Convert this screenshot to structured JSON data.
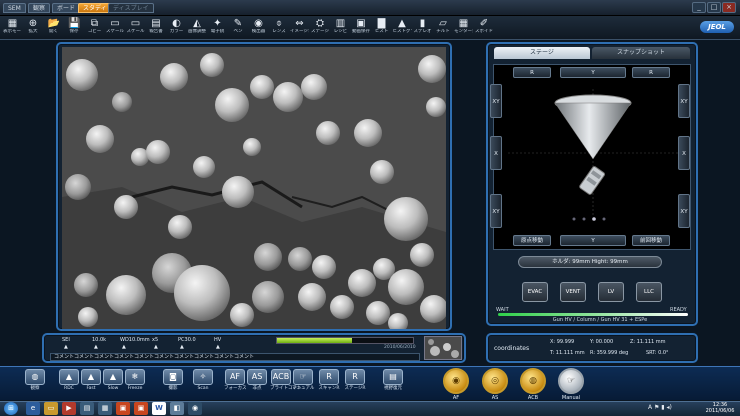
{
  "titlebar": {
    "tabs": [
      {
        "label": "SEM",
        "state": "normal"
      },
      {
        "label": "観察",
        "state": "normal"
      },
      {
        "label": "ボード",
        "state": "normal"
      },
      {
        "label": "スタディ",
        "state": "active"
      },
      {
        "label": "ディスプレイ",
        "state": "dim"
      }
    ],
    "controls": [
      "_",
      "□",
      "×"
    ]
  },
  "toolbar": {
    "items": [
      {
        "icon": "display-mode-icon",
        "glyph": "▦",
        "label": "表示モード"
      },
      {
        "icon": "zoom-icon",
        "glyph": "⊕",
        "label": "拡大"
      },
      {
        "icon": "open-folder-icon",
        "glyph": "📂",
        "label": "開く"
      },
      {
        "icon": "save-icon",
        "glyph": "💾",
        "label": "保存"
      },
      {
        "icon": "copy-icon",
        "glyph": "⧉",
        "label": "コピー"
      },
      {
        "icon": "scale-icon",
        "glyph": "▭",
        "label": "スケール"
      },
      {
        "icon": "scale2-icon",
        "glyph": "▭",
        "label": "スケール"
      },
      {
        "icon": "report-icon",
        "glyph": "▤",
        "label": "報告書"
      },
      {
        "icon": "color-icon",
        "glyph": "◐",
        "label": "カラー"
      },
      {
        "icon": "image-adjust-icon",
        "glyph": "◭",
        "label": "画像調整"
      },
      {
        "icon": "electron-icon",
        "glyph": "✦",
        "label": "電子銃"
      },
      {
        "icon": "pencil-icon",
        "glyph": "✎",
        "label": "ペン"
      },
      {
        "icon": "detector-icon",
        "glyph": "◉",
        "label": "検出器"
      },
      {
        "icon": "lens-icon",
        "glyph": "⌽",
        "label": "レンズ"
      },
      {
        "icon": "image-shift-icon",
        "glyph": "⇔",
        "label": "イメージシフト"
      },
      {
        "icon": "stage-icon",
        "glyph": "⛭",
        "label": "ステージ"
      },
      {
        "icon": "recipe-icon",
        "glyph": "▥",
        "label": "レシピ"
      },
      {
        "icon": "video-icon",
        "glyph": "▣",
        "label": "動画保存"
      },
      {
        "icon": "histogram-icon",
        "glyph": "▇",
        "label": "ヒスト"
      },
      {
        "icon": "histogram2-icon",
        "glyph": "▲",
        "label": "ヒストグラム"
      },
      {
        "icon": "stereo-icon",
        "glyph": "▮",
        "label": "ステレオ"
      },
      {
        "icon": "tilt-icon",
        "glyph": "▱",
        "label": "チルト"
      },
      {
        "icon": "montage-icon",
        "glyph": "▦",
        "label": "モンタージュ"
      },
      {
        "icon": "eyedropper-icon",
        "glyph": "✐",
        "label": "スポイド"
      }
    ],
    "logo": "JEOL"
  },
  "right_panel": {
    "tabs": [
      {
        "label": "ステージ",
        "active": true
      },
      {
        "label": "スナップショット",
        "active": false
      }
    ],
    "top_buttons": [
      "R",
      "Y",
      "R"
    ],
    "side_left": [
      "XY",
      "X",
      "XY"
    ],
    "side_right": [
      "XY",
      "X",
      "XY"
    ],
    "bottom_buttons": [
      "原点移動",
      "Y",
      "前回移動"
    ],
    "holder_text": "ホルダ:  99mm    Hight:  99mm",
    "vac_buttons": [
      "EVAC",
      "VENT",
      "LV",
      "LLC"
    ],
    "wait_label": "WAIT",
    "ready_label": "READY",
    "status_text": "Gun HV / Column / Gun HV 31 + ESPe"
  },
  "info": {
    "params": [
      {
        "label": "SEI",
        "value": "SEI"
      },
      {
        "label": "10.0k",
        "value": "10.0k"
      },
      {
        "label": "WD10.0mm",
        "value": "WD10.0mm"
      },
      {
        "label": "x5",
        "value": "x5"
      },
      {
        "label": "PC30.0",
        "value": "PC30.0"
      },
      {
        "label": "HV",
        "value": "HV"
      }
    ],
    "progress": 0.55,
    "date": "2010/06/2010",
    "comment": "コメントコメントコメントコメントコメントコメントコメントコメントコメントコメント"
  },
  "coordinates": {
    "title": "coordinates",
    "x": "X: 99.999",
    "y": "Y: 00.000",
    "z": "Z: 11.111 mm",
    "t": "T: 11.111 mm",
    "r": "R: 359.999 deg",
    "srt": "SRT:  0.0°"
  },
  "bottom_bar": {
    "buttons": [
      {
        "icon": "observe-icon",
        "glyph": "◍",
        "label": "観察"
      },
      {
        "icon": "rdc-icon",
        "glyph": "▲",
        "label": "RDC"
      },
      {
        "icon": "fast-icon",
        "glyph": "▲",
        "label": "Fast"
      },
      {
        "icon": "slow-icon",
        "glyph": "▲",
        "label": "Slow"
      },
      {
        "icon": "freeze-icon",
        "glyph": "❄",
        "label": "Freeze"
      },
      {
        "icon": "capture-icon",
        "glyph": "◙",
        "label": "撮影"
      },
      {
        "icon": "scan-icon",
        "glyph": "✧",
        "label": "Scan"
      },
      {
        "icon": "af-icon",
        "glyph": "AF",
        "label": "フォーカス"
      },
      {
        "icon": "as-icon",
        "glyph": "AS",
        "label": "非点"
      },
      {
        "icon": "acb-icon",
        "glyph": "ACB",
        "label": "ブライトコント"
      },
      {
        "icon": "manual-icon",
        "glyph": "☞",
        "label": "マニュアル"
      },
      {
        "icon": "scan-r-icon",
        "glyph": "R",
        "label": "スキャンR"
      },
      {
        "icon": "stage-r-icon",
        "glyph": "R",
        "label": "ステージR"
      },
      {
        "icon": "multi-icon",
        "glyph": "▤",
        "label": "視野復元"
      }
    ],
    "round": [
      {
        "icon": "af-round-icon",
        "label": "AF"
      },
      {
        "icon": "as-round-icon",
        "label": "AS"
      },
      {
        "icon": "acb-round-icon",
        "label": "ACB"
      },
      {
        "icon": "manual-round-icon",
        "label": "Manual"
      }
    ]
  },
  "taskbar": {
    "clock_time": "12:36",
    "clock_date": "2011/06/06"
  }
}
